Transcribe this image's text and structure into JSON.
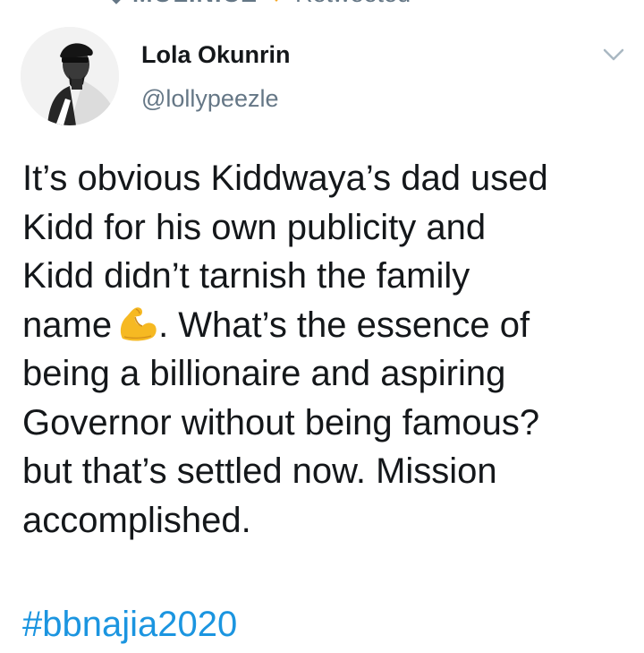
{
  "retweet": {
    "name": "MOLINICE",
    "label": "Retweeted",
    "icon": "retweet-icon",
    "badge_icon": "heart-badge-icon"
  },
  "user": {
    "name": "Lola Okunrin",
    "handle": "@lollypeezle",
    "avatar_icon": "avatar"
  },
  "menu_icon": "chevron-down-icon",
  "tweet": {
    "line1": "It’s obvious Kiddwaya’s dad used",
    "line2": "Kidd for his own publicity and",
    "line3": "Kidd didn’t tarnish the family",
    "line4_before": "name",
    "line4_emoji": "💪",
    "line4_after": ". What’s the essence of",
    "line5": "being a billionaire and aspiring",
    "line6": "Governor without being famous?",
    "line7": "but that’s settled now. Mission",
    "line8": "accomplished.",
    "hashtag": "#bbnajia2020"
  },
  "colors": {
    "text": "#14171a",
    "secondary": "#657786",
    "link": "#1b95e0",
    "emoji": "#f6b922"
  }
}
